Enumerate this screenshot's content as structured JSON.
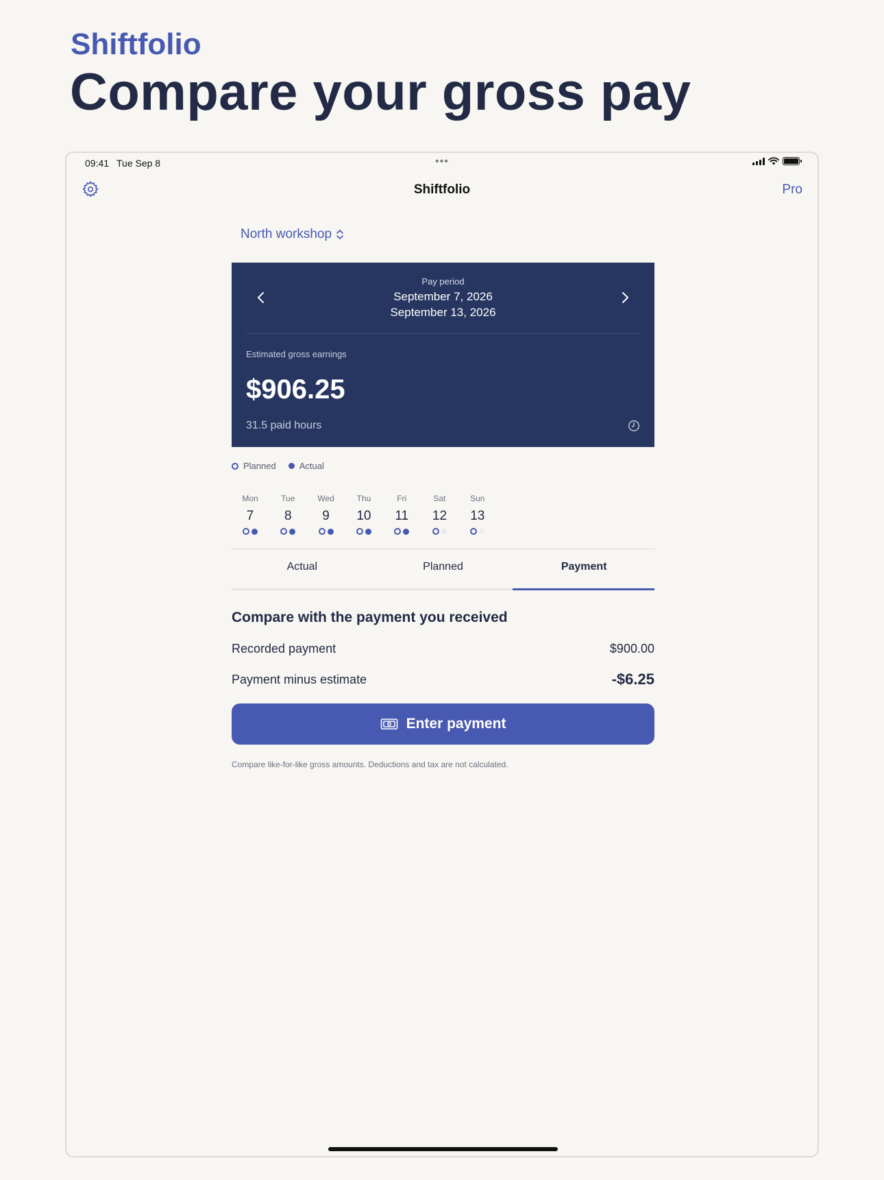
{
  "brand": "Shiftfolio",
  "headline": "Compare your gross pay",
  "status_bar": {
    "time": "09:41",
    "date": "Tue Sep 8",
    "dots": "•••"
  },
  "nav": {
    "title": "Shiftfolio",
    "pro": "Pro"
  },
  "location": {
    "label": "North workshop"
  },
  "pay_card": {
    "period_label": "Pay period",
    "period_start": "September 7, 2026",
    "period_end": "September 13, 2026",
    "estimate_label": "Estimated gross earnings",
    "amount": "$906.25",
    "hours": "31.5 paid hours"
  },
  "legend": {
    "planned": "Planned",
    "actual": "Actual"
  },
  "week": {
    "days": [
      {
        "name": "Mon",
        "num": "7",
        "planned": true,
        "actual": true
      },
      {
        "name": "Tue",
        "num": "8",
        "planned": true,
        "actual": true
      },
      {
        "name": "Wed",
        "num": "9",
        "planned": true,
        "actual": true
      },
      {
        "name": "Thu",
        "num": "10",
        "planned": true,
        "actual": true
      },
      {
        "name": "Fri",
        "num": "11",
        "planned": true,
        "actual": true
      },
      {
        "name": "Sat",
        "num": "12",
        "planned": true,
        "actual": false
      },
      {
        "name": "Sun",
        "num": "13",
        "planned": true,
        "actual": false
      }
    ]
  },
  "tabs": [
    {
      "label": "Actual",
      "active": false
    },
    {
      "label": "Planned",
      "active": false
    },
    {
      "label": "Payment",
      "active": true
    }
  ],
  "compare": {
    "title": "Compare with the payment you received",
    "recorded_label": "Recorded payment",
    "recorded_value": "$900.00",
    "diff_label": "Payment minus estimate",
    "diff_value": "-$6.25",
    "button": "Enter payment",
    "note": "Compare like-for-like gross amounts. Deductions and tax are not calculated."
  },
  "colors": {
    "accent": "#4859b1",
    "card": "#273660",
    "text": "#232a45",
    "background": "#f7f6f2"
  },
  "icons": [
    "gear-icon",
    "chevron-updown-icon",
    "chevron-left-icon",
    "chevron-right-icon",
    "clock-icon",
    "money-icon"
  ]
}
